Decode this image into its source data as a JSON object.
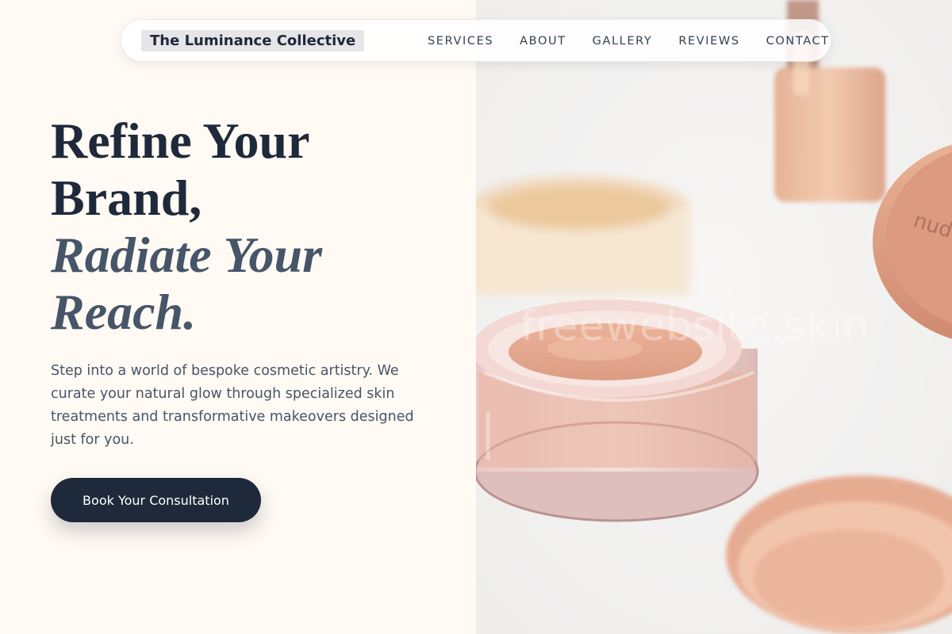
{
  "brand": {
    "name": "The Luminance Collective"
  },
  "nav": {
    "links": [
      "SERVICES",
      "ABOUT",
      "GALLERY",
      "REVIEWS",
      "CONTACT"
    ]
  },
  "hero": {
    "headline_line1": "Refine Your",
    "headline_line2": "Brand,",
    "headline_line3": "Radiate Your",
    "headline_line4": "Reach.",
    "intro": "Step into a world of bespoke cosmetic artistry. We curate your natural glow through specialized skin treatments and transformative makeovers designed just for you.",
    "cta_label": "Book Your Consultation",
    "photo_watermark": "freewebsite.skin"
  },
  "colors": {
    "accent": "#1e293b",
    "background": "#fffaf3",
    "muted_text": "#475569"
  }
}
